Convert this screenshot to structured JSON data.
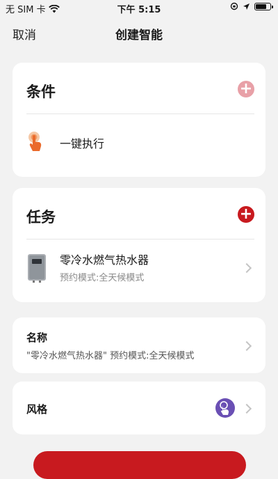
{
  "status_bar": {
    "carrier": "无 SIM 卡",
    "time": "下午 5:15",
    "battery_level": 0.85
  },
  "nav": {
    "cancel": "取消",
    "title": "创建智能"
  },
  "conditions": {
    "heading": "条件",
    "add_icon": "plus-icon",
    "accent_color": "#e8a0a7",
    "items": [
      {
        "label": "一键执行",
        "icon": "tap-hand-icon"
      }
    ]
  },
  "tasks": {
    "heading": "任务",
    "add_icon": "plus-icon",
    "accent_color": "#c81a1f",
    "items": [
      {
        "title": "零冷水燃气热水器",
        "subtitle": "预约模式:全天候模式",
        "icon": "water-heater-icon"
      }
    ]
  },
  "name_row": {
    "label": "名称",
    "value": "\"零冷水燃气热水器\" 预约模式:全天候模式"
  },
  "style_row": {
    "label": "风格",
    "icon": "tap-hand-icon",
    "icon_color": "#6a4fb4"
  }
}
